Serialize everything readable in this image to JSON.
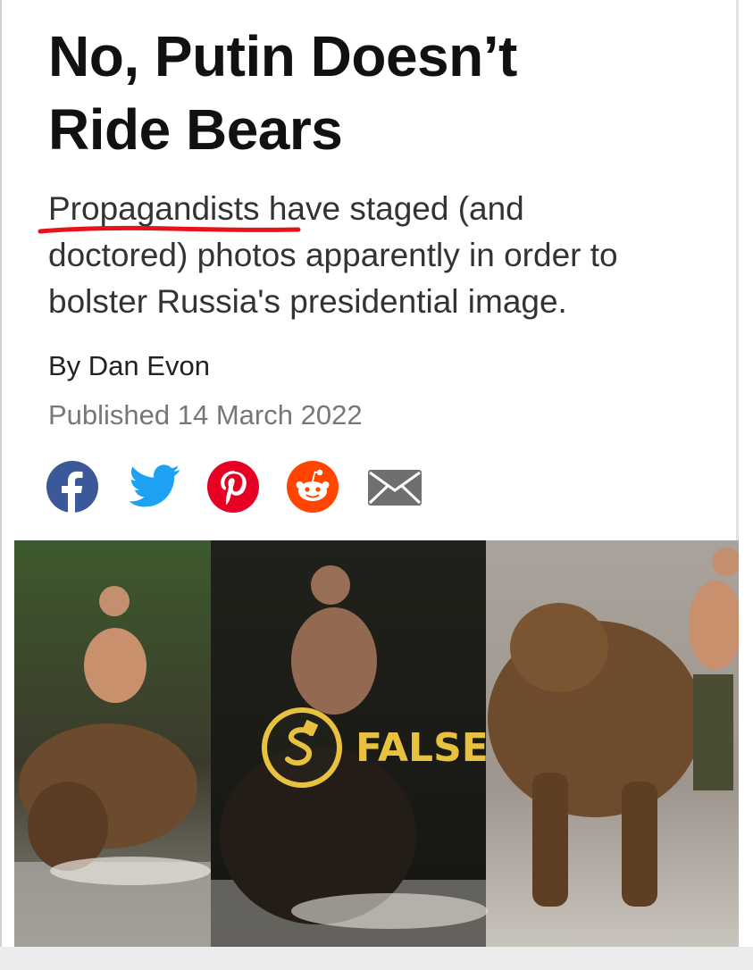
{
  "article": {
    "headline_line1": "No, Putin Doesn’t",
    "headline_line2": "Ride Bears",
    "dek_line1": "Propagandists have staged (and",
    "dek_line2": "doctored) photos apparently in order to",
    "dek_line3": "bolster Russia's presidential image.",
    "byline": "By Dan Evon",
    "published": "Published 14 March 2022"
  },
  "share": {
    "icons": [
      "facebook-icon",
      "twitter-icon",
      "pinterest-icon",
      "reddit-icon",
      "email-icon"
    ],
    "colors": {
      "facebook": "#3b5998",
      "twitter": "#1da1f2",
      "pinterest": "#e60023",
      "reddit": "#ff4500",
      "email": "#6f6f6f"
    }
  },
  "hero": {
    "rating": "FALSE",
    "rating_color": "#e8c23f",
    "highlight_color": "#e5141b"
  }
}
